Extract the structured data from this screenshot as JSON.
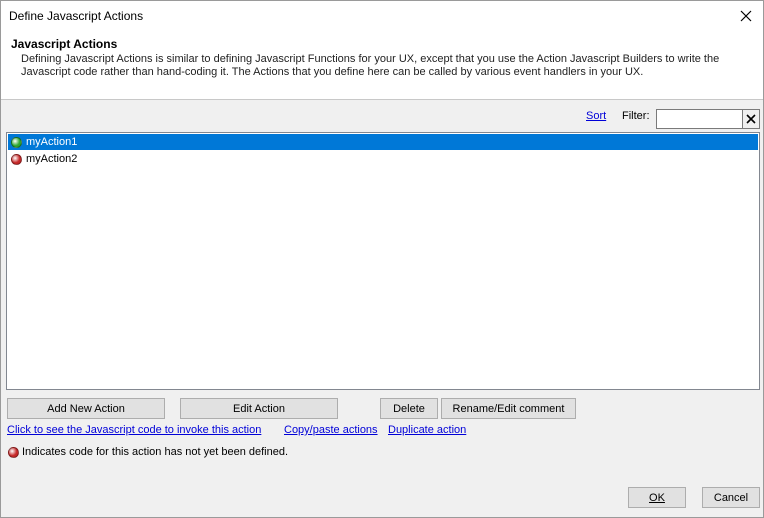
{
  "window": {
    "title": "Define Javascript Actions"
  },
  "header": {
    "title": "Javascript Actions",
    "description": "Defining Javascript Actions is similar to defining Javascript Functions for your UX, except that you use the Action Javascript Builders to write the Javascript code rather than hand-coding it. The Actions that you define here can be called by various event handlers in your UX."
  },
  "toolbar": {
    "sort_label": "Sort",
    "filter_label": "Filter:",
    "filter_value": ""
  },
  "actions": [
    {
      "name": "myAction1",
      "status": "defined",
      "selected": true
    },
    {
      "name": "myAction2",
      "status": "undefined",
      "selected": false
    }
  ],
  "colors": {
    "defined": "#2fa82f",
    "undefined": "#c62828",
    "selection": "#0078d7",
    "link": "#0000d8"
  },
  "buttons": {
    "add": "Add New Action",
    "edit": "Edit Action",
    "delete": "Delete",
    "rename": "Rename/Edit comment",
    "ok": "OK",
    "cancel": "Cancel"
  },
  "links": {
    "show_code": "Click to see the Javascript code to invoke this action",
    "copy_paste": "Copy/paste actions",
    "duplicate": "Duplicate action"
  },
  "legend": {
    "text": "Indicates code for this action has not yet been defined."
  }
}
